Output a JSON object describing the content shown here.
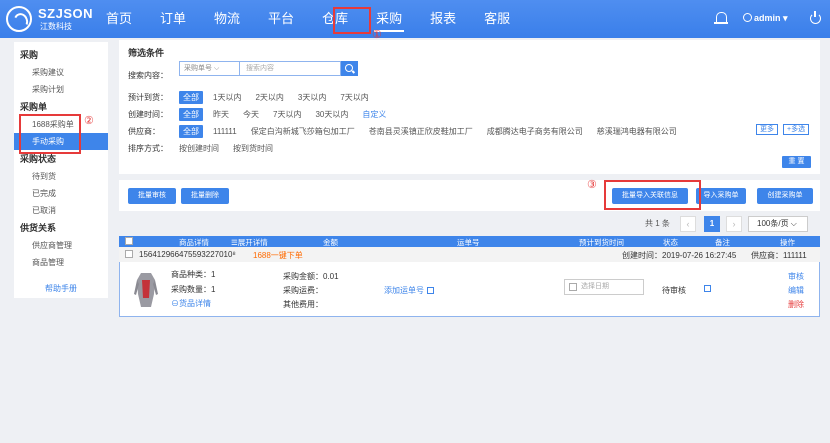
{
  "brand": {
    "title": "SZJSON",
    "subtitle": "江数科技"
  },
  "nav": {
    "items": [
      "首页",
      "订单",
      "物流",
      "平台",
      "仓库",
      "采购",
      "报表",
      "客服"
    ],
    "active": "采购"
  },
  "user": {
    "name": "admin ▾"
  },
  "annotations": {
    "one": "①",
    "two": "②",
    "three": "③"
  },
  "sidebar": {
    "groups": [
      {
        "label": "采购",
        "items": [
          "采购建议",
          "采购计划"
        ]
      },
      {
        "label": "采购单",
        "items": [
          "1688采购单",
          "手动采购"
        ]
      },
      {
        "label": "采购状态",
        "items": [
          "待到货",
          "已完成",
          "已取消"
        ]
      },
      {
        "label": "供货关系",
        "items": [
          "供应商管理",
          "商品管理"
        ]
      }
    ],
    "active_item": "手动采购",
    "help": "帮助手册"
  },
  "filter": {
    "title": "筛选条件",
    "search_label": "搜索内容：",
    "search_field": "采购单号 ⌵",
    "search_placeholder": "搜索内容",
    "arrival_label": "预计到货：",
    "arrival_options": [
      "全部",
      "1天以内",
      "2天以内",
      "3天以内",
      "7天以内"
    ],
    "created_label": "创建时间：",
    "created_options": [
      "全部",
      "昨天",
      "今天",
      "7天以内",
      "30天以内",
      "自定义"
    ],
    "supplier_label": "供应商：",
    "supplier_options": [
      "全部",
      "111111",
      "保定白沟新城飞莎箱包加工厂",
      "苍南县灵溪镇正欣皮鞋加工厂",
      "成都腾达电子商务有限公司",
      "慈溪瑞鸿电器有限公司"
    ],
    "more": "更多",
    "multi": "+多选",
    "sort_label": "排序方式：",
    "sort_options": [
      "按创建时间",
      "按到货时间"
    ],
    "reset": "重 置"
  },
  "actions": {
    "batch_review": "批量审核",
    "batch_delete": "批量删除",
    "batch_import": "批量导入关联信息",
    "import": "导入采购单",
    "create": "创建采购单"
  },
  "pager": {
    "total": "共 1 条",
    "prev": "‹",
    "current": "1",
    "next": "›",
    "size": "100条/页 ⌵"
  },
  "table": {
    "headers": [
      "商品详情",
      "☰展开详情",
      "金额",
      "运单号",
      "预计到货时间",
      "状态",
      "备注",
      "操作"
    ],
    "order": {
      "id": "156412966475593227010⁸",
      "source": "1688一键下单",
      "created": "创建时间：2019-07-26 16:27:45",
      "supplier": "供应商：111111",
      "kinds": "商品种类：1",
      "qty": "采购数量：1",
      "detail_link": "⊖货品详情",
      "amount": "采购金额：0.01",
      "freight": "采购运费：",
      "other": "其他费用：",
      "waybill": "添加运单号",
      "date_placeholder": "选择日期",
      "status": "待审核",
      "ops": [
        "审核",
        "编辑",
        "删除"
      ]
    }
  },
  "colors": {
    "primary": "#3e85ea",
    "highlight": "#e63a3a",
    "delete": "#e63a3a",
    "warn": "#ff6a00"
  }
}
